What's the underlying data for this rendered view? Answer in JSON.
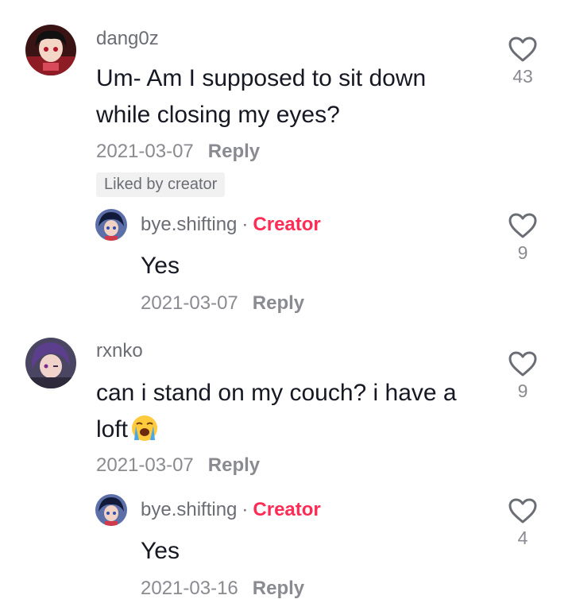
{
  "colors": {
    "creator_accent": "#fe2c55",
    "meta_gray": "#8a8b91",
    "badge_bg": "#f1f1f2"
  },
  "comments": [
    {
      "username": "dang0z",
      "text": "Um- Am I supposed to sit down while closing my eyes?",
      "date": "2021-03-07",
      "reply_label": "Reply",
      "badge": "Liked by creator",
      "likes": "43",
      "icon": "heart-outline-icon",
      "replies": [
        {
          "username": "bye.shifting",
          "separator": "·",
          "role": "Creator",
          "text": "Yes",
          "date": "2021-03-07",
          "reply_label": "Reply",
          "likes": "9"
        }
      ]
    },
    {
      "username": "rxnko",
      "text": "can i stand on my couch? i have a loft",
      "emoji": "loudly-crying-face-emoji",
      "date": "2021-03-07",
      "reply_label": "Reply",
      "likes": "9",
      "replies": [
        {
          "username": "bye.shifting",
          "separator": "·",
          "role": "Creator",
          "text": "Yes",
          "date": "2021-03-16",
          "reply_label": "Reply",
          "likes": "4"
        }
      ]
    }
  ]
}
